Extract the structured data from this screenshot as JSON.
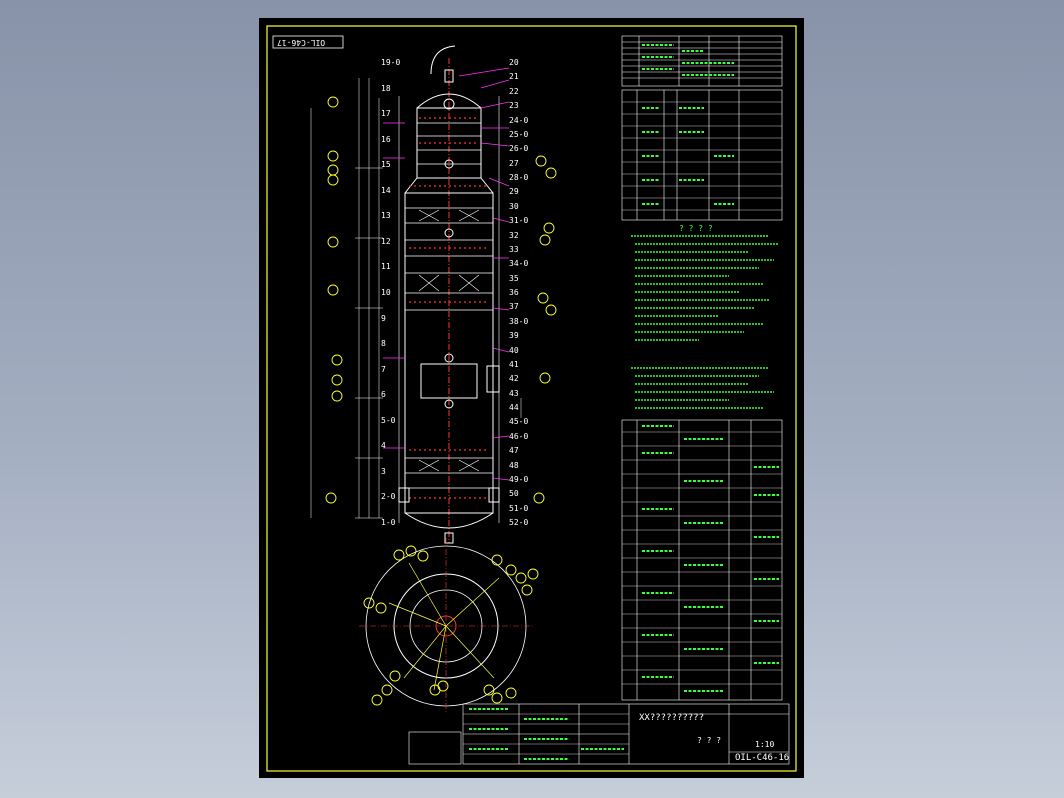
{
  "drawing": {
    "stamp_top": "OIL-C46-17",
    "drawing_no": "OIL-C46-16",
    "company": "XX??????????",
    "title_block_chars": "? ? ?",
    "scale_label": "1:10"
  },
  "colors": {
    "background": "#8e99ae",
    "sheet": "#000000",
    "frame": "#ffff33",
    "text_green": "#39ff3a",
    "text_white": "#ffffff",
    "leader_magenta": "#ff33ff",
    "centerline_red": "#ff3333",
    "cyan": "#33ffff"
  },
  "callouts": {
    "left": [
      "19-0",
      "18",
      "17",
      "16",
      "15",
      "14",
      "13",
      "12",
      "11",
      "10",
      "9",
      "8",
      "7",
      "6",
      "5-0",
      "4",
      "3",
      "2-0",
      "1-0"
    ],
    "right": [
      "20",
      "21",
      "22",
      "23",
      "24-0",
      "25-0",
      "26-0",
      "27",
      "28-0",
      "29",
      "30",
      "31-0",
      "32",
      "33",
      "34-0",
      "35",
      "36",
      "37",
      "38-0",
      "39",
      "40",
      "41",
      "42",
      "43",
      "44",
      "45-0",
      "46-0",
      "47",
      "48",
      "49-0",
      "50",
      "51-0",
      "52-0"
    ]
  },
  "notes_heading": "? ? ? ?"
}
